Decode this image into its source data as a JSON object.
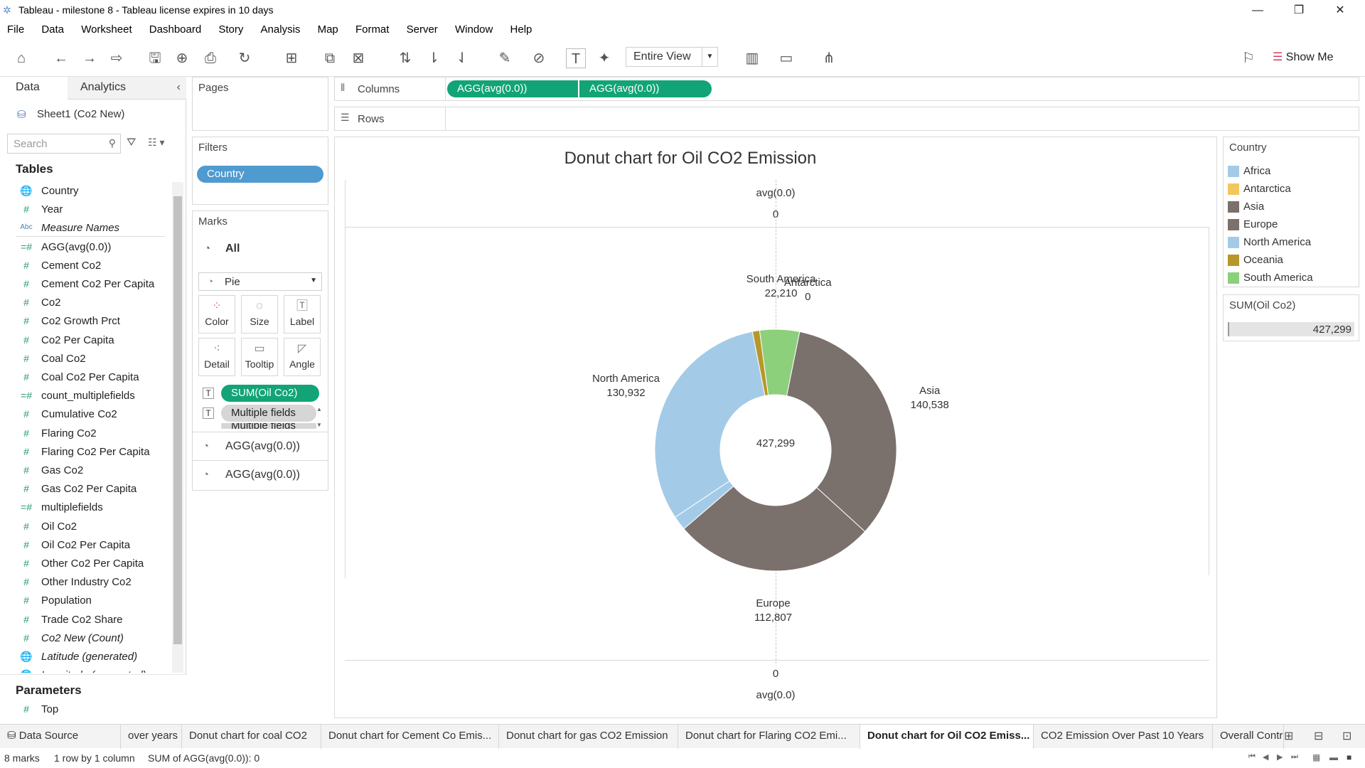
{
  "window": {
    "title": "Tableau - milestone 8 - Tableau license expires in 10 days",
    "minimize": "—",
    "restore": "❐",
    "close": "✕"
  },
  "menu": [
    "File",
    "Data",
    "Worksheet",
    "Dashboard",
    "Story",
    "Analysis",
    "Map",
    "Format",
    "Server",
    "Window",
    "Help"
  ],
  "toolbar": {
    "fit_value": "Entire View",
    "show_me_label": "Show Me"
  },
  "data_pane": {
    "tab_data": "Data",
    "tab_analytics": "Analytics",
    "datasource": "Sheet1 (Co2 New)",
    "search_placeholder": "Search",
    "tables_heading": "Tables",
    "parameters_heading": "Parameters",
    "fields": [
      {
        "icon": "🌐",
        "label": "Country"
      },
      {
        "icon": "#",
        "label": "Year"
      },
      {
        "icon": "Abc",
        "label": "Measure Names",
        "italic": true
      },
      {
        "icon": "=#",
        "label": "AGG(avg(0.0))"
      },
      {
        "icon": "#",
        "label": "Cement Co2"
      },
      {
        "icon": "#",
        "label": "Cement Co2 Per Capita"
      },
      {
        "icon": "#",
        "label": "Co2"
      },
      {
        "icon": "#",
        "label": "Co2 Growth Prct"
      },
      {
        "icon": "#",
        "label": "Co2 Per Capita"
      },
      {
        "icon": "#",
        "label": "Coal Co2"
      },
      {
        "icon": "#",
        "label": "Coal Co2 Per Capita"
      },
      {
        "icon": "=#",
        "label": "count_multiplefields"
      },
      {
        "icon": "#",
        "label": "Cumulative Co2"
      },
      {
        "icon": "#",
        "label": "Flaring Co2"
      },
      {
        "icon": "#",
        "label": "Flaring Co2 Per Capita"
      },
      {
        "icon": "#",
        "label": "Gas Co2"
      },
      {
        "icon": "#",
        "label": "Gas Co2 Per Capita"
      },
      {
        "icon": "=#",
        "label": "multiplefields"
      },
      {
        "icon": "#",
        "label": "Oil Co2"
      },
      {
        "icon": "#",
        "label": "Oil Co2 Per Capita"
      },
      {
        "icon": "#",
        "label": "Other Co2 Per Capita"
      },
      {
        "icon": "#",
        "label": "Other Industry Co2"
      },
      {
        "icon": "#",
        "label": "Population"
      },
      {
        "icon": "#",
        "label": "Trade Co2 Share"
      },
      {
        "icon": "#",
        "label": "Co2 New (Count)",
        "italic": true
      },
      {
        "icon": "🌐",
        "label": "Latitude (generated)",
        "italic": true
      },
      {
        "icon": "🌐",
        "label": "Longitude (generated)",
        "italic": true
      }
    ],
    "parameters": [
      {
        "icon": "#",
        "label": "Top"
      }
    ]
  },
  "shelves": {
    "pages": "Pages",
    "filters": "Filters",
    "filter_pill": "Country",
    "columns": "Columns",
    "rows": "Rows",
    "column_pills": [
      "AGG(avg(0.0))",
      "AGG(avg(0.0))"
    ]
  },
  "marks": {
    "title": "Marks",
    "all": "All",
    "mark_type": "Pie",
    "buttons": [
      "Color",
      "Size",
      "Label",
      "Detail",
      "Tooltip",
      "Angle"
    ],
    "pill_1": "SUM(Oil Co2)",
    "pill_2": "Multiple fields",
    "pill_3": "Multiple fields",
    "sub_1": "AGG(avg(0.0))",
    "sub_2": "AGG(avg(0.0))"
  },
  "view": {
    "top_axis_title": "avg(0.0)",
    "top_axis_tick": "0",
    "bottom_axis_tick": "0",
    "bottom_axis_title": "avg(0.0)"
  },
  "chart_data": {
    "type": "pie",
    "title": "Donut chart for Oil CO2 Emission",
    "center_label": "427,299",
    "total": 427299,
    "slices": [
      {
        "name": "Antarctica",
        "value": 0,
        "label": "0",
        "color": "#a3cbe8"
      },
      {
        "name": "Asia",
        "value": 140538,
        "label": "140,538",
        "color": "#7a706c"
      },
      {
        "name": "Europe",
        "value": 112807,
        "label": "112,807",
        "color": "#7a706c"
      },
      {
        "name": "Africa",
        "value": 8000,
        "label": "",
        "color": "#a3cbe8"
      },
      {
        "name": "North America",
        "value": 130932,
        "label": "130,932",
        "color": "#a3cbe8"
      },
      {
        "name": "Oceania",
        "value": 4000,
        "label": "",
        "color": "#b7972a"
      },
      {
        "name": "South America",
        "value": 22210,
        "label": "22,210",
        "color": "#8dd07b"
      }
    ]
  },
  "legend": {
    "title": "Country",
    "items": [
      {
        "label": "Africa",
        "color": "#a3cbe8"
      },
      {
        "label": "Antarctica",
        "color": "#f2c75c"
      },
      {
        "label": "Asia",
        "color": "#7a706c"
      },
      {
        "label": "Europe",
        "color": "#7a706c"
      },
      {
        "label": "North America",
        "color": "#a3cbe8"
      },
      {
        "label": "Oceania",
        "color": "#b7972a"
      },
      {
        "label": "South America",
        "color": "#8dd07b"
      }
    ]
  },
  "size_legend": {
    "title": "SUM(Oil Co2)",
    "value": "427,299"
  },
  "sheet_tabs": {
    "data_source": "Data Source",
    "tabs": [
      "over years",
      "Donut chart for coal CO2",
      "Donut chart for Cement Co Emis...",
      "Donut chart for gas CO2 Emission",
      "Donut chart for Flaring CO2 Emi...",
      "Donut chart for Oil CO2 Emiss...",
      "CO2 Emission Over Past 10 Years",
      "Overall Contr"
    ],
    "active_index": 5
  },
  "status": {
    "marks": "8 marks",
    "rows": "1 row by 1 column",
    "sum": "SUM of AGG(avg(0.0)): 0"
  }
}
